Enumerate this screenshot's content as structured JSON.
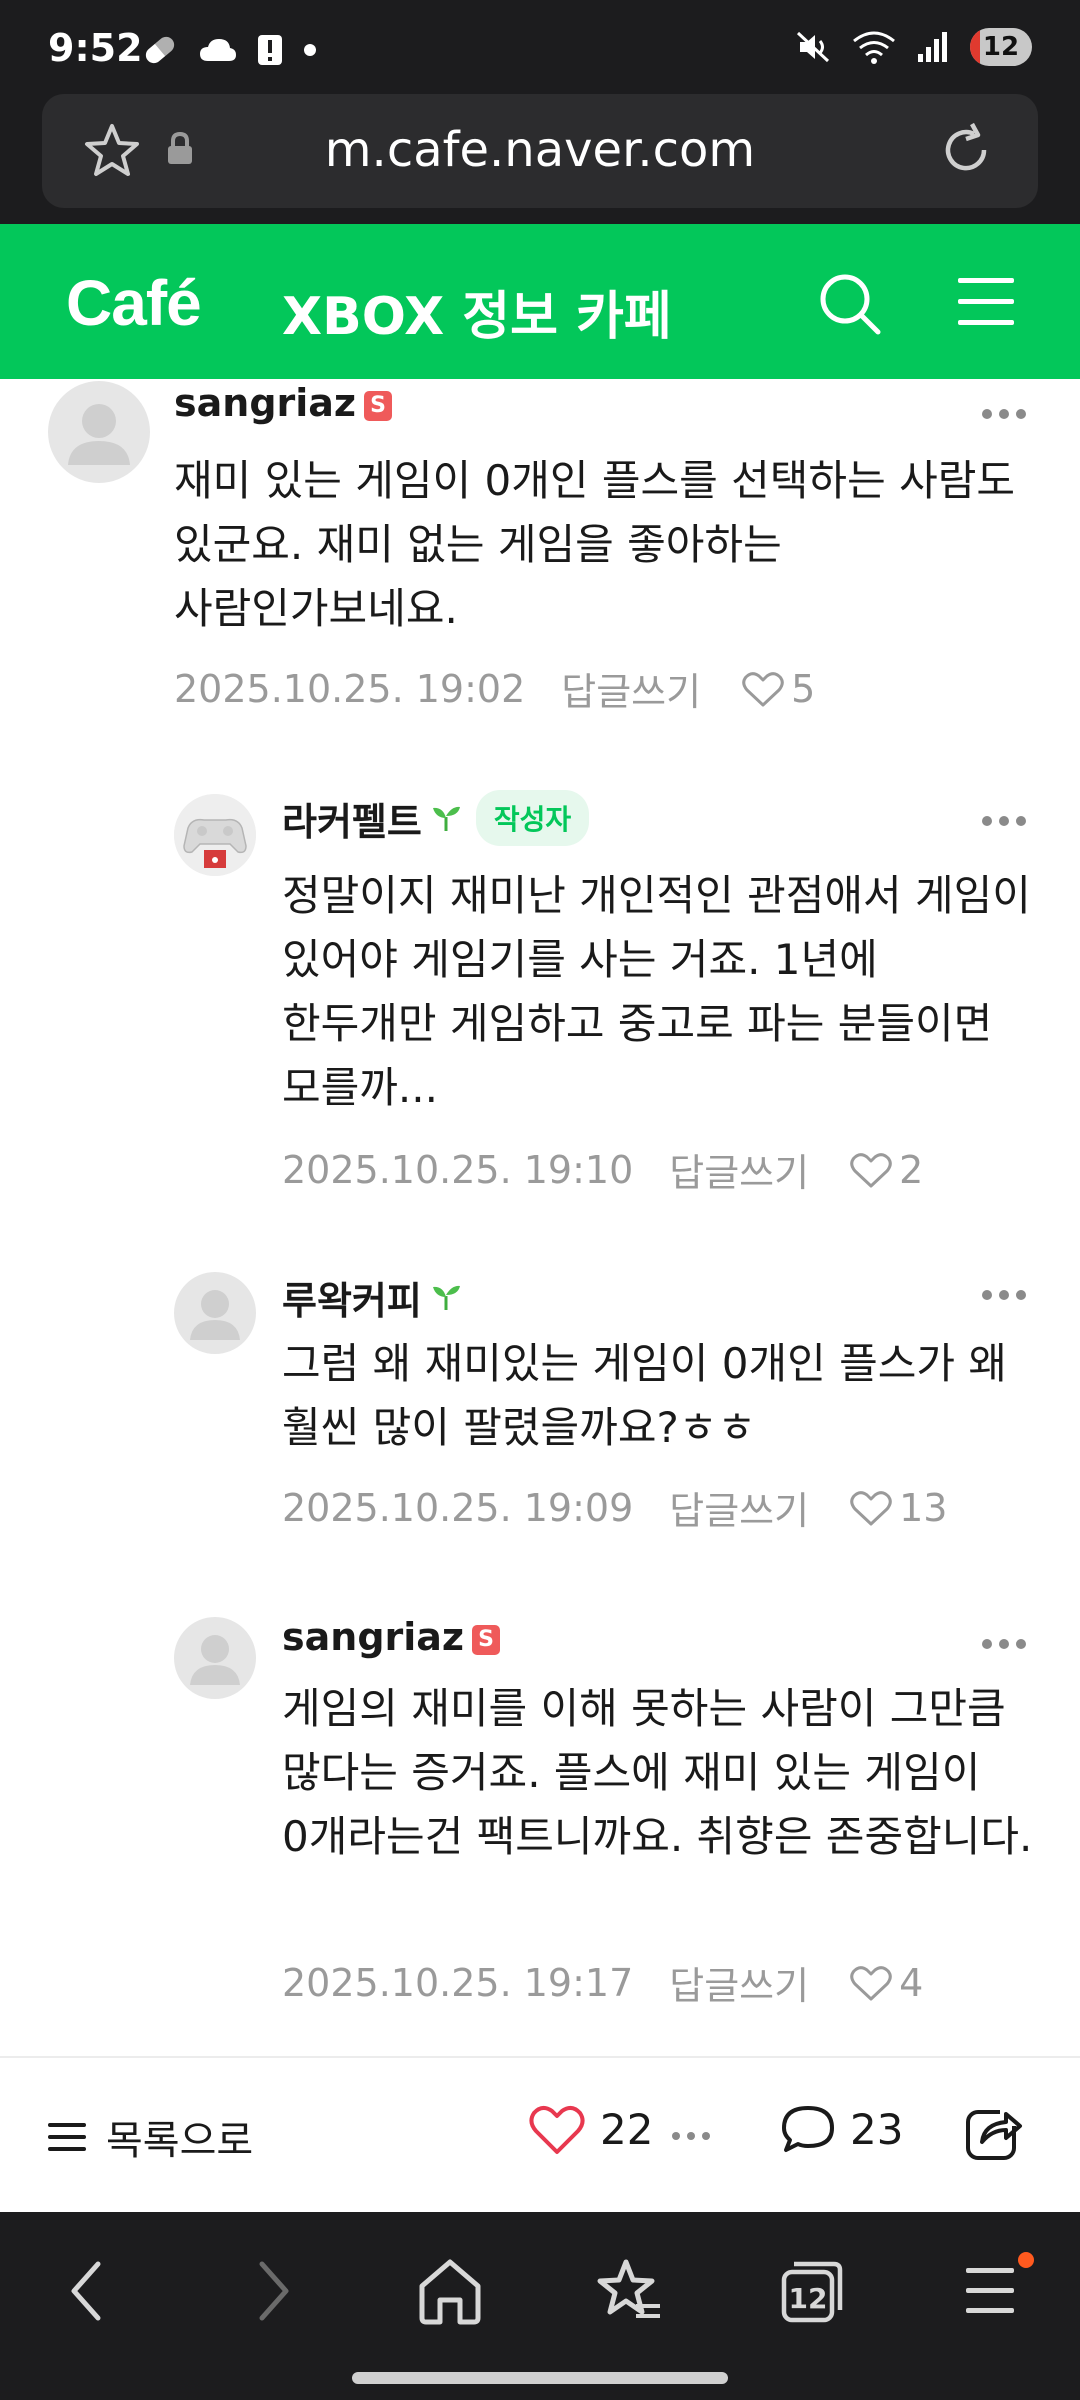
{
  "status_bar": {
    "time": "9:52",
    "tab_count": "12",
    "icons": [
      "pill-icon",
      "cloud-icon",
      "alert-icon",
      "dot-icon",
      "mute-icon",
      "wifi-icon",
      "signal-icon",
      "battery-icon"
    ]
  },
  "browser": {
    "url": "m.cafe.naver.com"
  },
  "cafe": {
    "logo": "Café",
    "title": "XBOX 정보 카페",
    "brand_color": "#03c75a"
  },
  "comments": [
    {
      "author": "sangriaz",
      "badge": "S",
      "text": "재미 있는 게임이 0개인 플스를 선택하는 사람도 있군요. 재미 없는 게임을 좋아하는 사람인가보네요.",
      "date": "2025.10.25. 19:02",
      "reply_label": "답글쓰기",
      "likes": "5"
    },
    {
      "author": "라커펠트",
      "author_tag": "작성자",
      "text": "정말이지 재미난 개인적인 관점애서 게임이 있어야 게임기를 사는 거죠. 1년에 한두개만 게임하고 중고로 파는 분들이면 모를까...",
      "date": "2025.10.25. 19:10",
      "reply_label": "답글쓰기",
      "likes": "2"
    },
    {
      "author": "루왁커피",
      "text": "그럼 왜 재미있는 게임이 0개인 플스가 왜 훨씬 많이 팔렸을까요?ㅎㅎ",
      "date": "2025.10.25. 19:09",
      "reply_label": "답글쓰기",
      "likes": "13"
    },
    {
      "author": "sangriaz",
      "badge": "S",
      "text": "게임의 재미를 이해 못하는 사람이 그만큼 많다는 증거죠. 플스에 재미 있는 게임이 0개라는건 팩트니까요. 취향은 존중합니다.",
      "date": "2025.10.25. 19:17",
      "reply_label": "답글쓰기",
      "likes": "4"
    }
  ],
  "action_bar": {
    "list_label": "목록으로",
    "like_count": "22",
    "comment_count": "23"
  },
  "nav_bar": {
    "tab_count": "12"
  }
}
